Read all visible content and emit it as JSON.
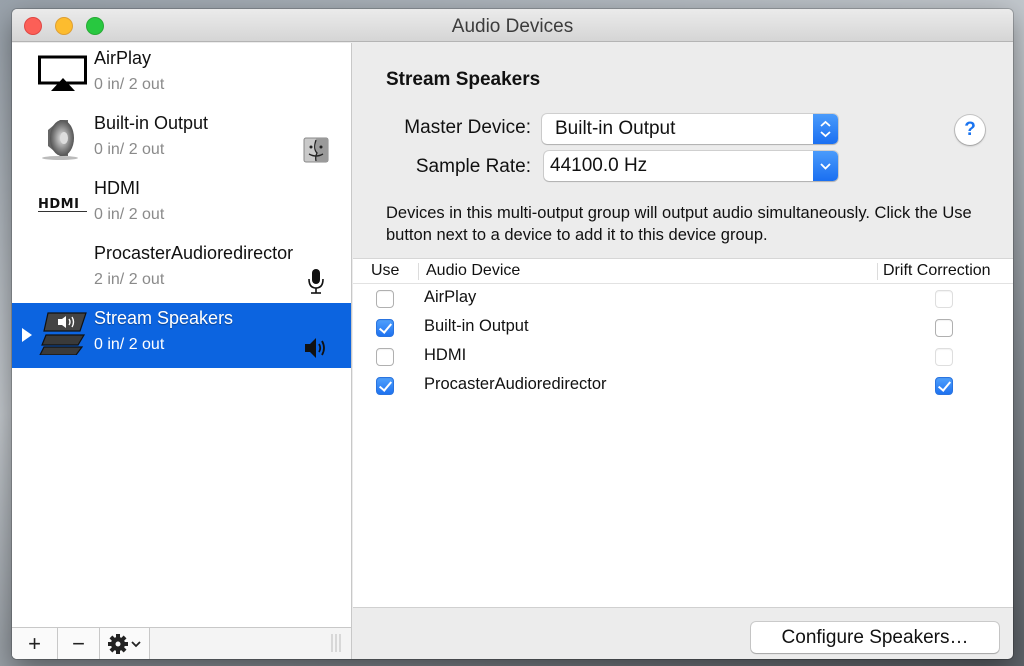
{
  "window": {
    "title": "Audio Devices"
  },
  "sidebar": {
    "devices": [
      {
        "name": "AirPlay",
        "io": "0 in/ 2 out",
        "icon": "airplay-icon",
        "status_icon": null,
        "selected": false
      },
      {
        "name": "Built-in Output",
        "io": "0 in/ 2 out",
        "icon": "speaker-icon",
        "status_icon": "finder-icon",
        "selected": false
      },
      {
        "name": "HDMI",
        "io": "0 in/ 2 out",
        "icon": "hdmi-icon",
        "status_icon": null,
        "selected": false
      },
      {
        "name": "ProcasterAudioredirector",
        "io": "2 in/ 2 out",
        "icon": null,
        "status_icon": "microphone-icon",
        "selected": false
      },
      {
        "name": "Stream Speakers",
        "io": "0 in/ 2 out",
        "icon": "multi-output-icon",
        "status_icon": "volume-icon",
        "selected": true
      }
    ],
    "footer": {
      "add_label": "+",
      "remove_label": "−",
      "gear_icon": "gear-icon"
    }
  },
  "main": {
    "title": "Stream Speakers",
    "master_device_label": "Master Device:",
    "master_device_value": "Built-in Output",
    "sample_rate_label": "Sample Rate:",
    "sample_rate_value": "44100.0 Hz",
    "help_label": "?",
    "description": "Devices in this multi-output group will output audio simultaneously. Click the Use button next to a device to add it to this device group.",
    "table": {
      "columns": [
        "Use",
        "Audio Device",
        "Drift Correction"
      ],
      "rows": [
        {
          "use": false,
          "device": "AirPlay",
          "drift": false,
          "drift_enabled": false
        },
        {
          "use": true,
          "device": "Built-in Output",
          "drift": false,
          "drift_enabled": true
        },
        {
          "use": false,
          "device": "HDMI",
          "drift": false,
          "drift_enabled": false
        },
        {
          "use": true,
          "device": "ProcasterAudioredirector",
          "drift": true,
          "drift_enabled": true
        }
      ]
    },
    "configure_button": "Configure Speakers…"
  },
  "colors": {
    "selection": "#0c64e0",
    "accent": "#1e72f0"
  }
}
